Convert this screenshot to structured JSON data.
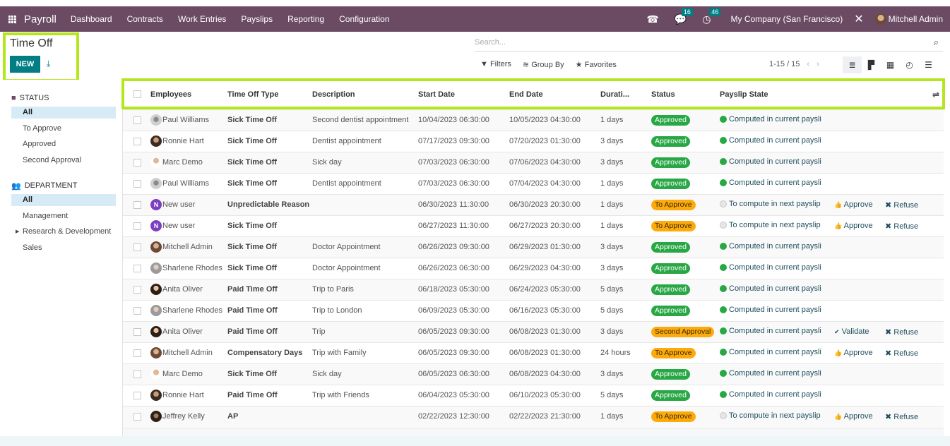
{
  "navbar": {
    "app_name": "Payroll",
    "menus": [
      "Dashboard",
      "Contracts",
      "Work Entries",
      "Payslips",
      "Reporting",
      "Configuration"
    ],
    "messages_count": "16",
    "activities_count": "46",
    "company": "My Company (San Francisco)",
    "user": "Mitchell Admin"
  },
  "control": {
    "title": "Time Off",
    "new_label": "NEW",
    "search_placeholder": "Search...",
    "filters_label": "Filters",
    "groupby_label": "Group By",
    "favorites_label": "Favorites",
    "pager": "1-15 / 15"
  },
  "sidebar": {
    "status_heading": "STATUS",
    "status_items": [
      "All",
      "To Approve",
      "Approved",
      "Second Approval"
    ],
    "department_heading": "DEPARTMENT",
    "department_items": [
      "All",
      "Management",
      "Research & Development",
      "Sales"
    ]
  },
  "table": {
    "columns": [
      "Employees",
      "Time Off Type",
      "Description",
      "Start Date",
      "End Date",
      "Durati...",
      "Status",
      "Payslip State"
    ],
    "rows": [
      {
        "employee": "Paul Williams",
        "type": "Sick Time Off",
        "description": "Second dentist appointment",
        "start": "10/04/2023 06:30:00",
        "end": "10/05/2023 04:30:00",
        "duration": "1 days",
        "status": "Approved",
        "payslip": "Computed in current paysli",
        "actions": []
      },
      {
        "employee": "Ronnie Hart",
        "type": "Sick Time Off",
        "description": "Dentist appointment",
        "start": "07/17/2023 09:30:00",
        "end": "07/20/2023 01:30:00",
        "duration": "3 days",
        "status": "Approved",
        "payslip": "Computed in current paysli",
        "actions": []
      },
      {
        "employee": "Marc Demo",
        "type": "Sick Time Off",
        "description": "Sick day",
        "start": "07/03/2023 06:30:00",
        "end": "07/06/2023 04:30:00",
        "duration": "3 days",
        "status": "Approved",
        "payslip": "Computed in current paysli",
        "actions": []
      },
      {
        "employee": "Paul Williams",
        "type": "Sick Time Off",
        "description": "Dentist appointment",
        "start": "07/03/2023 06:30:00",
        "end": "07/04/2023 04:30:00",
        "duration": "1 days",
        "status": "Approved",
        "payslip": "Computed in current paysli",
        "actions": []
      },
      {
        "employee": "New user",
        "type": "Unpredictable Reason",
        "description": "",
        "start": "06/30/2023 11:30:00",
        "end": "06/30/2023 20:30:00",
        "duration": "1 days",
        "status": "To Approve",
        "payslip": "To compute in next payslip",
        "actions": [
          "Approve",
          "Refuse"
        ]
      },
      {
        "employee": "New user",
        "type": "Sick Time Off",
        "description": "",
        "start": "06/27/2023 11:30:00",
        "end": "06/27/2023 20:30:00",
        "duration": "1 days",
        "status": "To Approve",
        "payslip": "To compute in next payslip",
        "actions": [
          "Approve",
          "Refuse"
        ]
      },
      {
        "employee": "Mitchell Admin",
        "type": "Sick Time Off",
        "description": "Doctor Appointment",
        "start": "06/26/2023 09:30:00",
        "end": "06/29/2023 01:30:00",
        "duration": "3 days",
        "status": "Approved",
        "payslip": "Computed in current paysli",
        "actions": []
      },
      {
        "employee": "Sharlene Rhodes",
        "type": "Sick Time Off",
        "description": "Doctor Appointment",
        "start": "06/26/2023 06:30:00",
        "end": "06/29/2023 04:30:00",
        "duration": "3 days",
        "status": "Approved",
        "payslip": "Computed in current paysli",
        "actions": []
      },
      {
        "employee": "Anita Oliver",
        "type": "Paid Time Off",
        "description": "Trip to Paris",
        "start": "06/18/2023 05:30:00",
        "end": "06/24/2023 05:30:00",
        "duration": "5 days",
        "status": "Approved",
        "payslip": "Computed in current paysli",
        "actions": []
      },
      {
        "employee": "Sharlene Rhodes",
        "type": "Paid Time Off",
        "description": "Trip to London",
        "start": "06/09/2023 05:30:00",
        "end": "06/16/2023 05:30:00",
        "duration": "5 days",
        "status": "Approved",
        "payslip": "Computed in current paysli",
        "actions": []
      },
      {
        "employee": "Anita Oliver",
        "type": "Paid Time Off",
        "description": "Trip",
        "start": "06/05/2023 09:30:00",
        "end": "06/08/2023 01:30:00",
        "duration": "3 days",
        "status": "Second Approval",
        "payslip": "Computed in current paysli",
        "actions": [
          "Validate",
          "Refuse"
        ]
      },
      {
        "employee": "Mitchell Admin",
        "type": "Compensatory Days",
        "description": "Trip with Family",
        "start": "06/05/2023 09:30:00",
        "end": "06/08/2023 01:30:00",
        "duration": "24 hours",
        "status": "To Approve",
        "payslip": "Computed in current paysli",
        "actions": [
          "Approve",
          "Refuse"
        ]
      },
      {
        "employee": "Marc Demo",
        "type": "Sick Time Off",
        "description": "Sick day",
        "start": "06/05/2023 06:30:00",
        "end": "06/08/2023 04:30:00",
        "duration": "3 days",
        "status": "Approved",
        "payslip": "Computed in current paysli",
        "actions": []
      },
      {
        "employee": "Ronnie Hart",
        "type": "Paid Time Off",
        "description": "Trip with Friends",
        "start": "06/04/2023 05:30:00",
        "end": "06/10/2023 05:30:00",
        "duration": "5 days",
        "status": "Approved",
        "payslip": "Computed in current paysli",
        "actions": []
      },
      {
        "employee": "Jeffrey Kelly",
        "type": "AP",
        "description": "",
        "start": "02/22/2023 12:30:00",
        "end": "02/22/2023 21:30:00",
        "duration": "1 days",
        "status": "To Approve",
        "payslip": "To compute in next payslip",
        "actions": [
          "Approve",
          "Refuse"
        ]
      }
    ]
  },
  "colors": {
    "navbar": "#6b4b63",
    "primary": "#017e84",
    "approved": "#28a745",
    "to_approve": "#fdab0c",
    "highlight": "#b5e61d"
  }
}
